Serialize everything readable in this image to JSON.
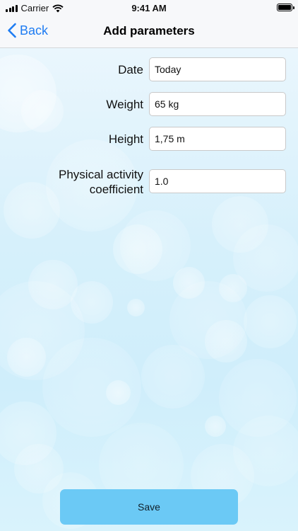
{
  "status_bar": {
    "carrier": "Carrier",
    "time": "9:41 AM"
  },
  "nav": {
    "back_label": "Back",
    "title": "Add parameters"
  },
  "form": {
    "date": {
      "label": "Date",
      "value": "Today"
    },
    "weight": {
      "label": "Weight",
      "value": "65 kg"
    },
    "height": {
      "label": "Height",
      "value": "1,75 m"
    },
    "activity": {
      "label_line1": "Physical activity",
      "label_line2": "coefficient",
      "value": "1.0"
    }
  },
  "save_label": "Save",
  "colors": {
    "accent": "#1e7cf2",
    "save_button": "#6bc9f5"
  }
}
